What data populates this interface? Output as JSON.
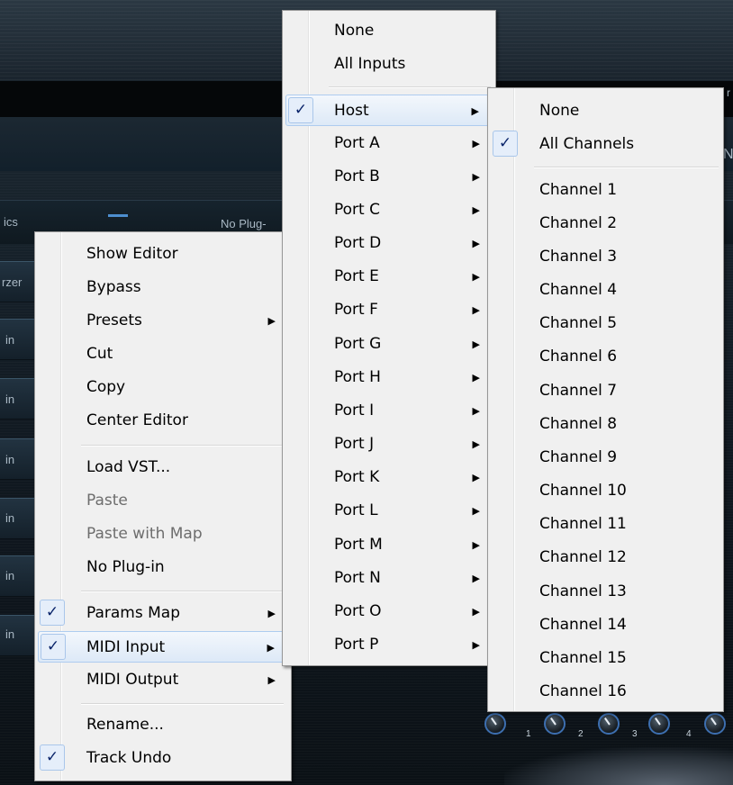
{
  "background": {
    "labels": [
      "ics",
      "No Plug-",
      "rzer",
      "in",
      "in",
      "in",
      "in",
      "in",
      "in"
    ],
    "knob_numbers": [
      "1",
      "2",
      "3",
      "4"
    ],
    "edge_glyphs": [
      "N",
      "r"
    ]
  },
  "context_menu": {
    "items": [
      {
        "label": "Show Editor"
      },
      {
        "label": "Bypass"
      },
      {
        "label": "Presets"
      },
      {
        "label": "Cut"
      },
      {
        "label": "Copy"
      },
      {
        "label": "Center Editor"
      },
      {
        "label": "Load VST..."
      },
      {
        "label": "Paste"
      },
      {
        "label": "Paste with Map"
      },
      {
        "label": "No Plug-in"
      },
      {
        "label": "Params Map"
      },
      {
        "label": "MIDI Input"
      },
      {
        "label": "MIDI Output"
      },
      {
        "label": "Rename..."
      },
      {
        "label": "Track Undo"
      }
    ]
  },
  "midi_input_menu": {
    "items": [
      {
        "label": "None"
      },
      {
        "label": "All Inputs"
      },
      {
        "label": "Host"
      },
      {
        "label": "Port A"
      },
      {
        "label": "Port B"
      },
      {
        "label": "Port C"
      },
      {
        "label": "Port D"
      },
      {
        "label": "Port E"
      },
      {
        "label": "Port F"
      },
      {
        "label": "Port G"
      },
      {
        "label": "Port H"
      },
      {
        "label": "Port I"
      },
      {
        "label": "Port J"
      },
      {
        "label": "Port K"
      },
      {
        "label": "Port L"
      },
      {
        "label": "Port M"
      },
      {
        "label": "Port N"
      },
      {
        "label": "Port O"
      },
      {
        "label": "Port P"
      }
    ]
  },
  "channel_menu": {
    "items": [
      {
        "label": "None"
      },
      {
        "label": "All Channels"
      },
      {
        "label": "Channel 1"
      },
      {
        "label": "Channel 2"
      },
      {
        "label": "Channel 3"
      },
      {
        "label": "Channel 4"
      },
      {
        "label": "Channel 5"
      },
      {
        "label": "Channel 6"
      },
      {
        "label": "Channel 7"
      },
      {
        "label": "Channel 8"
      },
      {
        "label": "Channel 9"
      },
      {
        "label": "Channel 10"
      },
      {
        "label": "Channel 11"
      },
      {
        "label": "Channel 12"
      },
      {
        "label": "Channel 13"
      },
      {
        "label": "Channel 14"
      },
      {
        "label": "Channel 15"
      },
      {
        "label": "Channel 16"
      }
    ]
  },
  "check_glyph": "✓",
  "submenu_glyph": "▶"
}
